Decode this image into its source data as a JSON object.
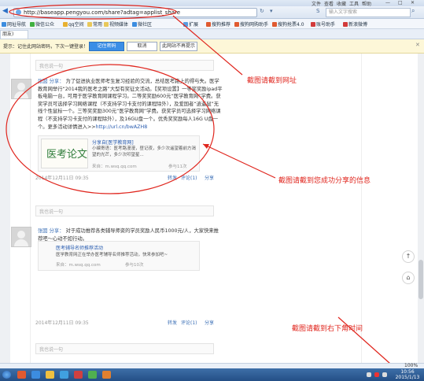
{
  "browser": {
    "menu": [
      "文件",
      "查看",
      "收藏",
      "工具",
      "帮助"
    ],
    "url": "http://baseapp.pengyou.com/share?adtag=applist_share",
    "search_placeholder": "输入文字搜索",
    "favorites": [
      "网址导航",
      "微信公众",
      "qq空间",
      "常用",
      "视频媒体",
      "微社区",
      "扩展",
      "搜狗推荐",
      "搜狗网购助手",
      "搜狗抢票4.0",
      "账号助手",
      "新浪微博"
    ],
    "tab_label": "朋友)",
    "infobar": {
      "text": "提示：记住此网站密码，下次一键登录！",
      "remember": "记住密码",
      "cancel": "取消",
      "never": "此网站不再提示"
    },
    "status_zoom": "100%"
  },
  "comment_placeholder": "我也说一句",
  "posts": [
    {
      "author": "张囡",
      "verb": "分享：",
      "body": "为了促进执业医师考生复习经验的交流，总结医考路上的得与失。医学教育网举行“2014我的医考之路”大型有奖征文活动。【奖项设置】一等奖奖励ipad平板电脑一台，可用于医学教育网课程学习。二等奖奖励600元“医学教育网”学费。获奖学员可选择学习网络课程（不支持学习卡支付的课程除外），及爱国者“逍遥鼠”无线个性鼠标一个。三等奖奖励300元“医学教育网”学费。获奖学员可选择学习网络课程（不支持学习卡支付的课程除外），及16GU盘一个。优秀奖奖励每人16G U盘一个。更多活动详情进入>>",
      "link": "http://url.cn/bwAZH8",
      "card": {
        "title": "分享自[医学教育网]",
        "desc": "小编寄语：医考路漫漫，昼记夜，多少次遥望着前方渴望的光芒，多少次叩望星...",
        "source": "来自：m.wsq.qq.com",
        "stats": "参与11次"
      },
      "time": "2014年12月11日 09:35",
      "actions": [
        "转发",
        "评论(1)",
        "分享"
      ]
    },
    {
      "author": "张囡",
      "verb": "分享：",
      "body": "对于成功推荐各类辅导师资的学员奖励人民币1000元/人，大家快来推荐吧～心动不如行动。",
      "card": {
        "title": "医考辅导名师推荐活动",
        "desc": "医学教育网正在举办医考辅导名师推荐活动，快来参加吧~",
        "source": "来自：m.wsq.qq.com",
        "stats": "参与10次"
      },
      "time": "2014年12月11日 09:35",
      "actions": [
        "转发",
        "评论(1)",
        "分享"
      ]
    }
  ],
  "annotations": {
    "url": "截图请截到网址",
    "share": "截图请截到您成功分享的信息",
    "time": "截图请截到右下角时间"
  },
  "taskbar": {
    "time": "10:56",
    "date": "2015/1/13"
  },
  "colors": {
    "annotation": "#e0261e",
    "link": "#2a5db0",
    "taskbar": "#2c5a92"
  }
}
